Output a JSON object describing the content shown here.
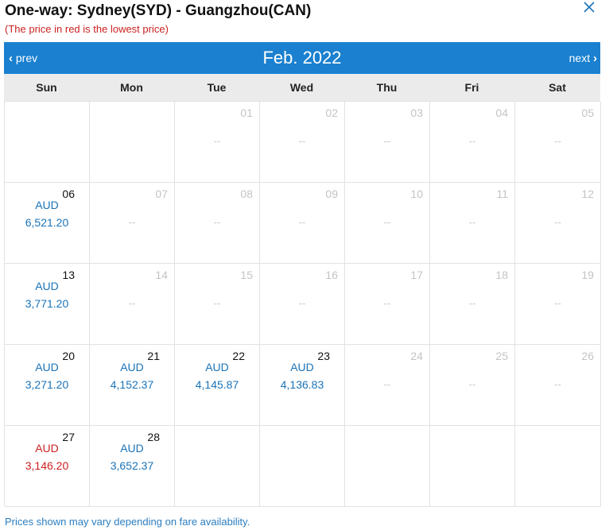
{
  "header": {
    "title": "One-way: Sydney(SYD) - Guangzhou(CAN)",
    "subtitle": "(The price in red is the lowest price)",
    "close_icon": "close-icon"
  },
  "calendar": {
    "prev_label": "prev",
    "next_label": "next",
    "month": "Feb. 2022",
    "accent_color": "#1a80cf",
    "lowest_price_color": "#cc2222",
    "price_color": "#1a73b8",
    "weekdays": [
      "Sun",
      "Mon",
      "Tue",
      "Wed",
      "Thu",
      "Fri",
      "Sat"
    ],
    "cells": [
      {
        "day": "",
        "currency": "",
        "price": "",
        "empty": true
      },
      {
        "day": "",
        "currency": "",
        "price": "",
        "empty": true
      },
      {
        "day": "01",
        "currency": "",
        "price": "--"
      },
      {
        "day": "02",
        "currency": "",
        "price": "--"
      },
      {
        "day": "03",
        "currency": "",
        "price": "--"
      },
      {
        "day": "04",
        "currency": "",
        "price": "--"
      },
      {
        "day": "05",
        "currency": "",
        "price": "--"
      },
      {
        "day": "06",
        "currency": "AUD",
        "price": "6,521.20"
      },
      {
        "day": "07",
        "currency": "",
        "price": "--"
      },
      {
        "day": "08",
        "currency": "",
        "price": "--"
      },
      {
        "day": "09",
        "currency": "",
        "price": "--"
      },
      {
        "day": "10",
        "currency": "",
        "price": "--"
      },
      {
        "day": "11",
        "currency": "",
        "price": "--"
      },
      {
        "day": "12",
        "currency": "",
        "price": "--"
      },
      {
        "day": "13",
        "currency": "AUD",
        "price": "3,771.20"
      },
      {
        "day": "14",
        "currency": "",
        "price": "--"
      },
      {
        "day": "15",
        "currency": "",
        "price": "--"
      },
      {
        "day": "16",
        "currency": "",
        "price": "--"
      },
      {
        "day": "17",
        "currency": "",
        "price": "--"
      },
      {
        "day": "18",
        "currency": "",
        "price": "--"
      },
      {
        "day": "19",
        "currency": "",
        "price": "--"
      },
      {
        "day": "20",
        "currency": "AUD",
        "price": "3,271.20"
      },
      {
        "day": "21",
        "currency": "AUD",
        "price": "4,152.37"
      },
      {
        "day": "22",
        "currency": "AUD",
        "price": "4,145.87"
      },
      {
        "day": "23",
        "currency": "AUD",
        "price": "4,136.83"
      },
      {
        "day": "24",
        "currency": "",
        "price": "--"
      },
      {
        "day": "25",
        "currency": "",
        "price": "--"
      },
      {
        "day": "26",
        "currency": "",
        "price": "--"
      },
      {
        "day": "27",
        "currency": "AUD",
        "price": "3,146.20",
        "lowest": true
      },
      {
        "day": "28",
        "currency": "AUD",
        "price": "3,652.37"
      },
      {
        "day": "",
        "currency": "",
        "price": "",
        "empty": true
      },
      {
        "day": "",
        "currency": "",
        "price": "",
        "empty": true
      },
      {
        "day": "",
        "currency": "",
        "price": "",
        "empty": true
      },
      {
        "day": "",
        "currency": "",
        "price": "",
        "empty": true
      },
      {
        "day": "",
        "currency": "",
        "price": "",
        "empty": true
      }
    ]
  },
  "footer": {
    "note": "Prices shown may vary depending on fare availability."
  }
}
